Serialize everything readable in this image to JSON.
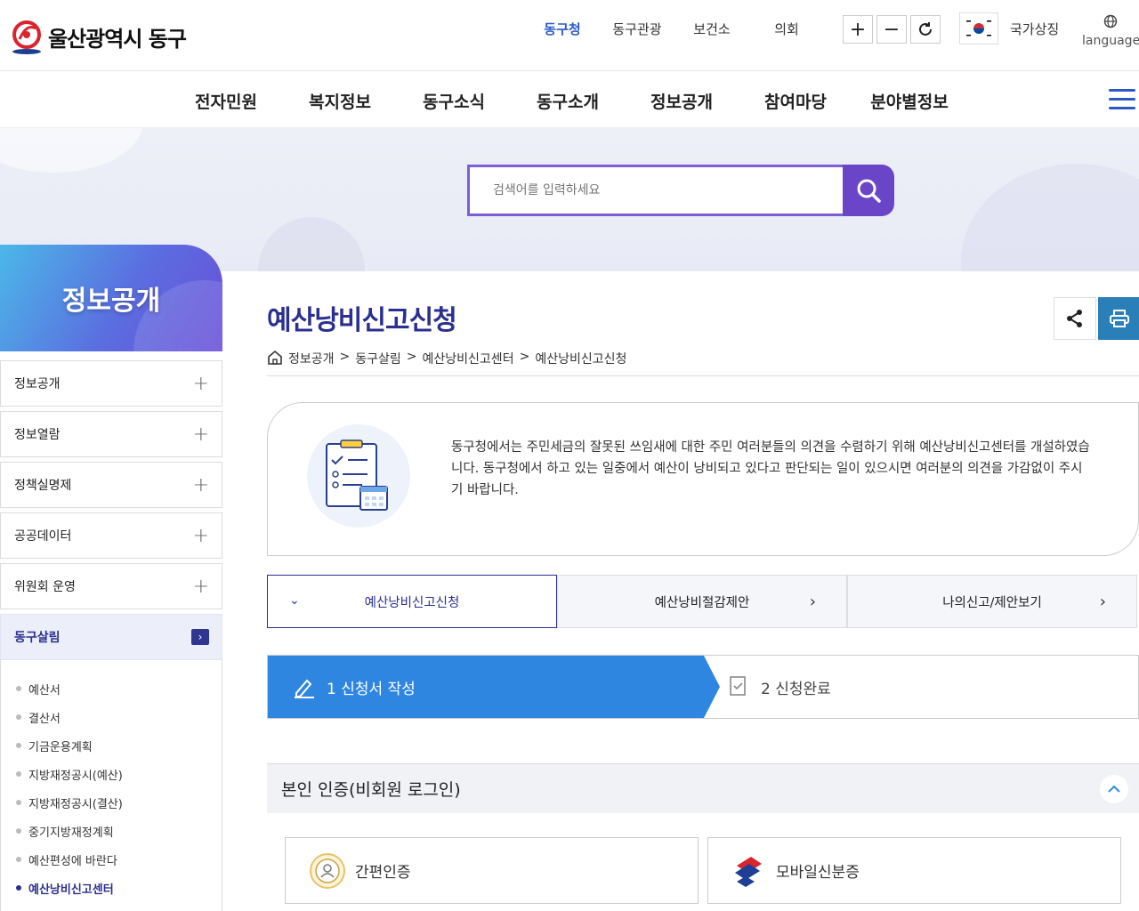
{
  "header": {
    "logo_text": "울산광역시 동구",
    "top_nav": [
      "동구청",
      "동구관광",
      "보건소",
      "의회"
    ],
    "active_top": "동구청",
    "zoom_in": "+",
    "zoom_out": "−",
    "national_symbol": "국가상징",
    "language": "language"
  },
  "main_menu": [
    "전자민원",
    "복지정보",
    "동구소식",
    "동구소개",
    "정보공개",
    "참여마당",
    "분야별정보"
  ],
  "search": {
    "placeholder": "검색어를 입력하세요"
  },
  "sidebar": {
    "title": "정보공개",
    "items": [
      {
        "label": "정보공개"
      },
      {
        "label": "정보열람"
      },
      {
        "label": "정책실명제"
      },
      {
        "label": "공공데이터"
      },
      {
        "label": "위원회 운영"
      }
    ],
    "active_item": "동구살림",
    "sub_items": [
      "예산서",
      "결산서",
      "기금운용계획",
      "지방재정공시(예산)",
      "지방재정공시(결산)",
      "중기지방재정계획",
      "예산편성에 바란다",
      "예산낭비신고센터"
    ],
    "active_sub": "예산낭비신고센터"
  },
  "page": {
    "title": "예산낭비신고신청",
    "breadcrumb": [
      "정보공개",
      "동구살림",
      "예산낭비신고센터",
      "예산낭비신고신청"
    ],
    "breadcrumb_sep": ">",
    "intro_text": "동구청에서는 주민세금의 잘못된 쓰임새에 대한 주민 여러분들의 의견을 수렴하기 위해 예산낭비신고센터를 개설하였습니다. 동구청에서 하고 있는 일중에서 예산이 낭비되고 있다고 판단되는 일이 있으시면 여러분의 의견을 가감없이 주시기 바랍니다.",
    "tabs": [
      "예산낭비신고신청",
      "예산낭비절감제안",
      "나의신고/제안보기"
    ],
    "steps": [
      "1 신청서 작성",
      "2 신청완료"
    ],
    "auth_title": "본인 인증(비회원 로그인)",
    "auth_options": [
      "간편인증",
      "모바일신분증"
    ]
  },
  "colors": {
    "accent": "#2b2f8f",
    "step_blue": "#2f86e0",
    "search_purple": "#6a45c8"
  },
  "icons": [
    "search-icon",
    "share-icon",
    "print-icon",
    "home-icon",
    "pen-icon",
    "check-doc-icon",
    "chevron-up-icon",
    "globe-icon"
  ]
}
